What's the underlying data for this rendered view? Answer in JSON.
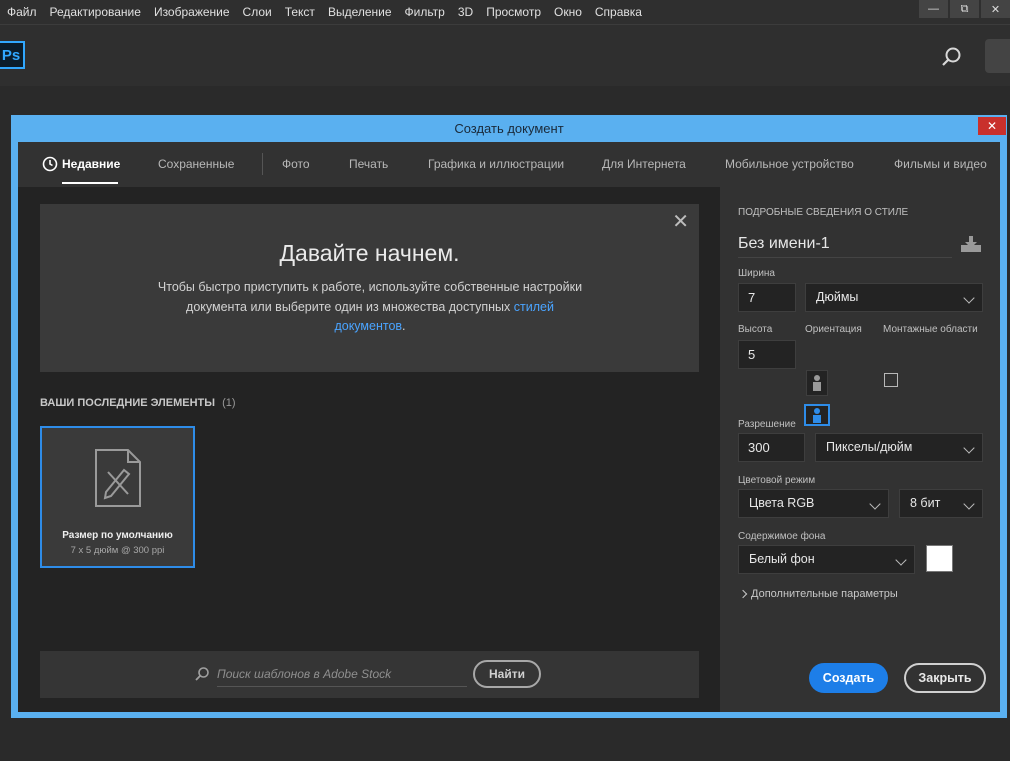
{
  "menu": [
    "Файл",
    "Редактирование",
    "Изображение",
    "Слои",
    "Текст",
    "Выделение",
    "Фильтр",
    "3D",
    "Просмотр",
    "Окно",
    "Справка"
  ],
  "window_buttons": [
    "—",
    "⧉",
    "✕"
  ],
  "app": {
    "logo": "Ps"
  },
  "dialog": {
    "title": "Создать документ",
    "close_glyph": "✕",
    "tabs": [
      "Недавние",
      "Сохраненные",
      "Фото",
      "Печать",
      "Графика и иллюстрации",
      "Для Интернета",
      "Мобильное устройство",
      "Фильмы и видео"
    ],
    "active_tab": "Недавние",
    "hero": {
      "title": "Давайте начнем.",
      "text_line1": "Чтобы быстро приступить к работе, используйте собственные настройки",
      "text_line2": "документа или выберите один из множества доступных",
      "link1": "стилей",
      "link2": "документов",
      "period": "."
    },
    "recent": {
      "heading": "ВАШИ ПОСЛЕДНИЕ ЭЛЕМЕНТЫ",
      "count": "(1)",
      "items": [
        {
          "name": "Размер по умолчанию",
          "details": "7 x 5 дюйм @ 300 ppi"
        }
      ]
    },
    "stock": {
      "placeholder": "Поиск шаблонов в Adobe Stock",
      "button": "Найти"
    },
    "preset": {
      "section_title": "ПОДРОБНЫЕ СВЕДЕНИЯ О СТИЛЕ",
      "doc_name": "Без имени-1",
      "width_label": "Ширина",
      "width_value": "7",
      "width_unit": "Дюймы",
      "height_label": "Высота",
      "height_value": "5",
      "orientation_label": "Ориентация",
      "artboards_label": "Монтажные области",
      "resolution_label": "Разрешение",
      "resolution_value": "300",
      "resolution_unit": "Пикселы/дюйм",
      "color_mode_label": "Цветовой режим",
      "color_mode": "Цвета RGB",
      "bit_depth": "8 бит",
      "background_label": "Содержимое фона",
      "background": "Белый фон",
      "background_color": "#ffffff",
      "advanced": "Дополнительные параметры",
      "create_button": "Создать",
      "close_button": "Закрыть"
    }
  },
  "colors": {
    "accent": "#2e8ce8",
    "dialog_frame": "#5ab0f0",
    "close_red": "#c9302c",
    "link": "#4aa4ff"
  }
}
